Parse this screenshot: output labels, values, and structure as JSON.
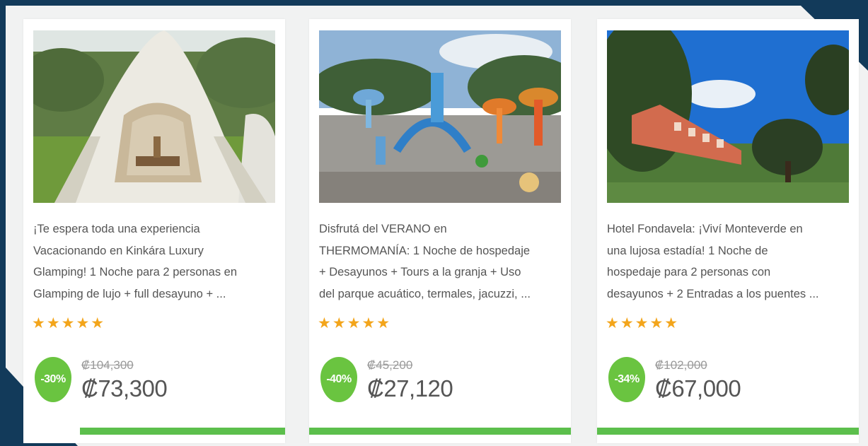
{
  "deals": [
    {
      "description": "¡Te espera toda una experiencia\nVacacionando en Kinkára Luxury\nGlamping! 1 Noche para 2 personas en\nGlamping de lujo + full desayuno + ...",
      "rating": 5,
      "stars": "★★★★★",
      "discount": "-30%",
      "old_price": "₡104,300",
      "price": "₡73,300"
    },
    {
      "description": "Disfrutá del VERANO en\nTHERMOMANÍA: 1 Noche de hospedaje\n+ Desayunos + Tours a la granja + Uso\ndel parque acuático, termales, jacuzzi, ...",
      "rating": 5,
      "stars": "★★★★★",
      "discount": "-40%",
      "old_price": "₡45,200",
      "price": "₡27,120"
    },
    {
      "description": "Hotel Fondavela: ¡Viví Monteverde en\nuna lujosa estadía! 1 Noche de\nhospedaje para 2 personas con\ndesayunos + 2 Entradas a los puentes ...",
      "rating": 5,
      "stars": "★★★★★",
      "discount": "-34%",
      "old_price": "₡102,000",
      "price": "₡67,000"
    }
  ],
  "colors": {
    "frame_background": "#123a5a",
    "panel_background": "#f1f2f2",
    "card_background": "#ffffff",
    "discount_badge": "#6ac440",
    "bottom_bar": "#5cbf4c",
    "star": "#f3a51b",
    "text": "#555555",
    "old_price": "#9a9a9a"
  }
}
